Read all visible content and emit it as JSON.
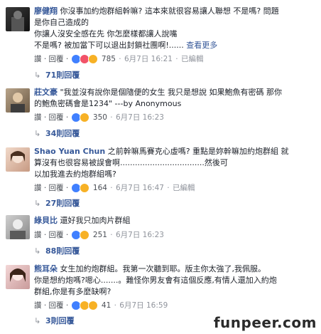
{
  "comments": [
    {
      "author": "廖健翔",
      "lines": [
        "你沒事加約炮群組幹嘛? 這本來就很容易讓人聯想 不是嗎? 問題",
        "是你自己造成的",
        "你讓人沒安全感在先 你怎麼樣都讓人說嘴",
        "不是嗎? 被加當下可以退出封鎖社團啊!......"
      ],
      "see_more": "查看更多",
      "reply": "讚 · 回覆 ·",
      "reaction_count": "785",
      "time": "6月7日 16:21",
      "edited": "已編輯",
      "replies": "71則回覆"
    },
    {
      "author": "莊文豪",
      "lines": [
        "\"我並沒有說你是個隨便的女生 我只是想說 如果鮑魚有密碼 那你",
        "的鮑魚密碼會是1234\" ---by Anonymous"
      ],
      "reply": "讚 · 回覆 ·",
      "reaction_count": "350",
      "time": "6月7日 16:23",
      "replies": "34則回覆"
    },
    {
      "author": "Shao Yuan Chun",
      "lines": [
        "之前幹嘛馬賽克心虛嗎? 重點是妳幹嘛加約炮群組 就",
        "算沒有也很容易被誤會啊..................................然後可",
        "以加我進去約炮群組嗎?"
      ],
      "reply": "讚 · 回覆 ·",
      "reaction_count": "164",
      "time": "6月7日 16:47",
      "edited": "已編輯",
      "replies": "27則回覆"
    },
    {
      "author": "綠貝比",
      "lines": [
        "還好我只加肉片群組"
      ],
      "reply": "讚 · 回覆 ·",
      "reaction_count": "251",
      "time": "6月7日 16:23",
      "replies": "88則回覆"
    },
    {
      "author": "熊耳朵",
      "lines": [
        "女生加約炮群組。我第一次聽到耶。版主你太強了,我佩服。",
        "你是想約炮嗎?嗯心.......。難怪你男友會有這個反應,有情人還加入約炮",
        "群組,你是有多麼缺啊?"
      ],
      "reply": "讚 · 回覆 ·",
      "reaction_count": "41",
      "time": "6月7日 16:59",
      "replies": "3則回覆"
    }
  ],
  "watermark": "funpeer.com"
}
